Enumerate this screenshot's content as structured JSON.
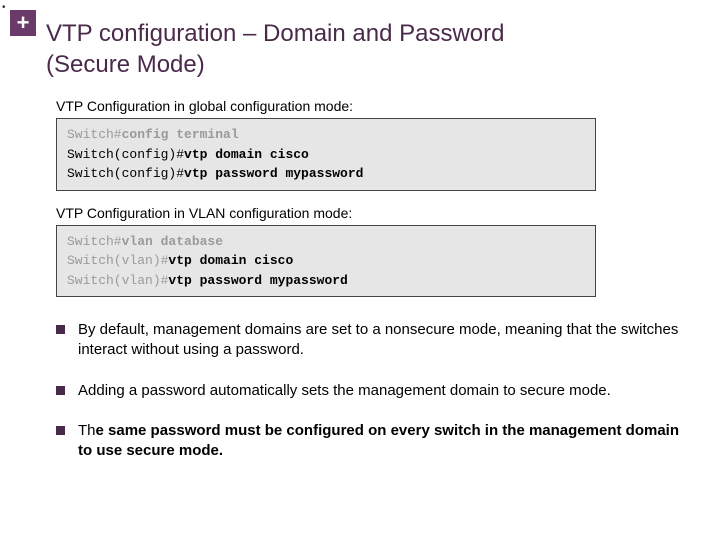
{
  "header": {
    "plus": "+",
    "dot": "•",
    "title_line1": "VTP configuration – Domain and Password",
    "title_line2": "(Secure Mode)"
  },
  "sections": {
    "global": {
      "label": "VTP Configuration in global configuration mode:",
      "lines": [
        {
          "prompt": "Switch#",
          "cmd": "config terminal"
        },
        {
          "prompt": "Switch(config)#",
          "cmd": "vtp domain cisco"
        },
        {
          "prompt": "Switch(config)#",
          "cmd": "vtp password mypassword"
        }
      ]
    },
    "vlan": {
      "label": "VTP Configuration in VLAN configuration mode:",
      "lines": [
        {
          "prompt": "Switch#",
          "cmd": "vlan database"
        },
        {
          "prompt": "Switch(vlan)#",
          "cmd": "vtp domain cisco"
        },
        {
          "prompt": "Switch(vlan)#",
          "cmd": "vtp password mypassword"
        }
      ]
    }
  },
  "bullets": {
    "b1": "By default, management domains are set to a nonsecure mode, meaning that the switches interact without using a password.",
    "b2": "Adding a password automatically sets the management domain to secure mode.",
    "b3_pre": "Th",
    "b3_bold": "e same password must be configured on every switch in the management domain to use secure mode."
  }
}
